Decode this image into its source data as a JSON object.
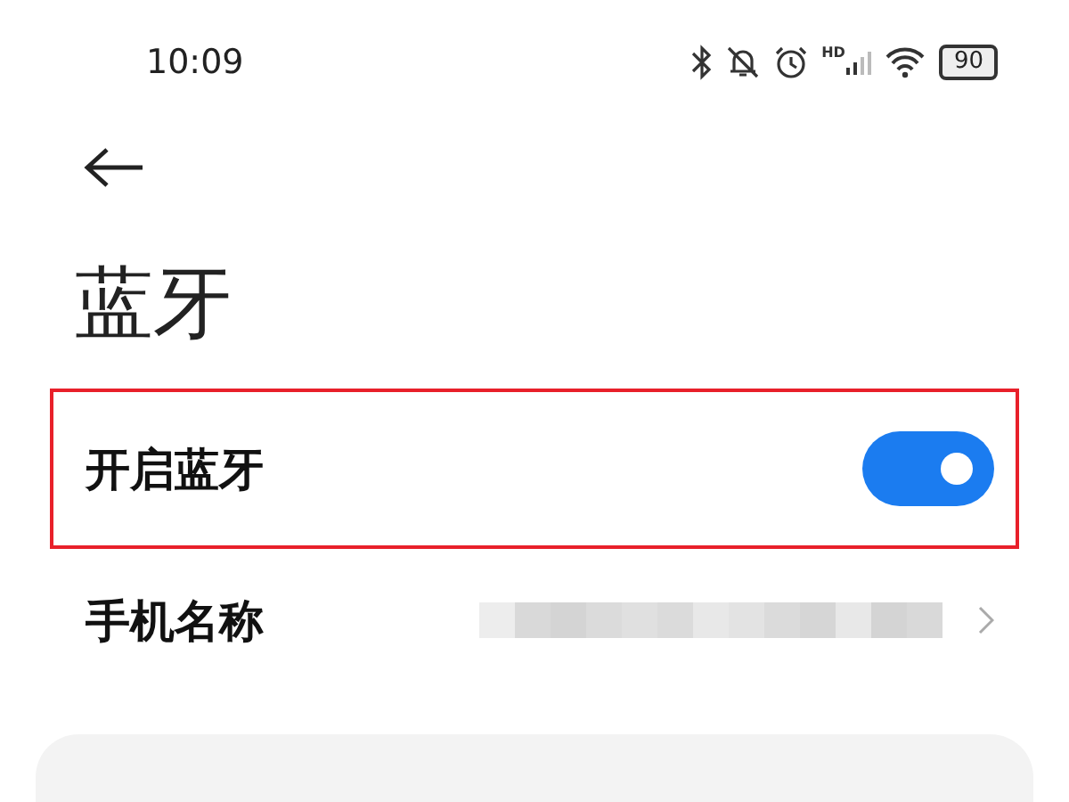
{
  "status_bar": {
    "time": "10:09",
    "signal_label": "HD",
    "battery": "90"
  },
  "title": "蓝牙",
  "settings": [
    {
      "kind": "toggle",
      "label": "开启蓝牙",
      "on": true,
      "highlighted": true
    },
    {
      "kind": "link",
      "label": "手机名称",
      "redacted": true,
      "highlighted": false
    }
  ]
}
